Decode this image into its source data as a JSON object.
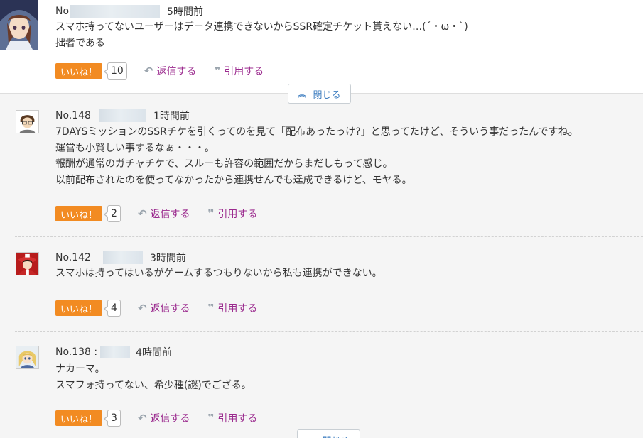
{
  "top_comment": {
    "number": "No",
    "time": "5時間前",
    "lines": [
      "スマホ持ってないユーザーはデータ連携できないからSSR確定チケット貰えない…(´・ω・`)",
      "拙者である"
    ],
    "like_label": "いいね！",
    "like_count": "10",
    "reply_label": "返信する",
    "quote_label": "引用する"
  },
  "close_label": "閉じる",
  "replies": [
    {
      "number": "No.148",
      "time": "1時間前",
      "lines": [
        "7DAYSミッションのSSRチケを引くってのを見て「配布あったっけ?」と思ってたけど、そういう事だったんですね。",
        "運営も小賢しい事するなぁ・・・。",
        "報酬が通常のガチャチケで、スルーも許容の範囲だからまだしもって感じ。",
        "以前配布されたのを使ってなかったから連携せんでも達成できるけど、モヤる。"
      ],
      "like_label": "いいね！",
      "like_count": "2",
      "reply_label": "返信する",
      "quote_label": "引用する"
    },
    {
      "number": "No.142",
      "time": "3時間前",
      "lines": [
        "スマホは持ってはいるがゲームするつもりないから私も連携ができない。"
      ],
      "like_label": "いいね！",
      "like_count": "4",
      "reply_label": "返信する",
      "quote_label": "引用する"
    },
    {
      "number": "No.138 :",
      "time": "4時間前",
      "lines": [
        "ナカーマ。",
        "スマフォ持ってない、希少種(謎)でござる。"
      ],
      "like_label": "いいね！",
      "like_count": "3",
      "reply_label": "返信する",
      "quote_label": "引用する"
    }
  ],
  "icons": {
    "reply": "reply-arrow-icon",
    "quote": "quote-icon",
    "close": "chevron-up-icon"
  },
  "colors": {
    "like": "#f28b22",
    "link": "#9b2a8e",
    "close_text": "#3a7bbf"
  }
}
